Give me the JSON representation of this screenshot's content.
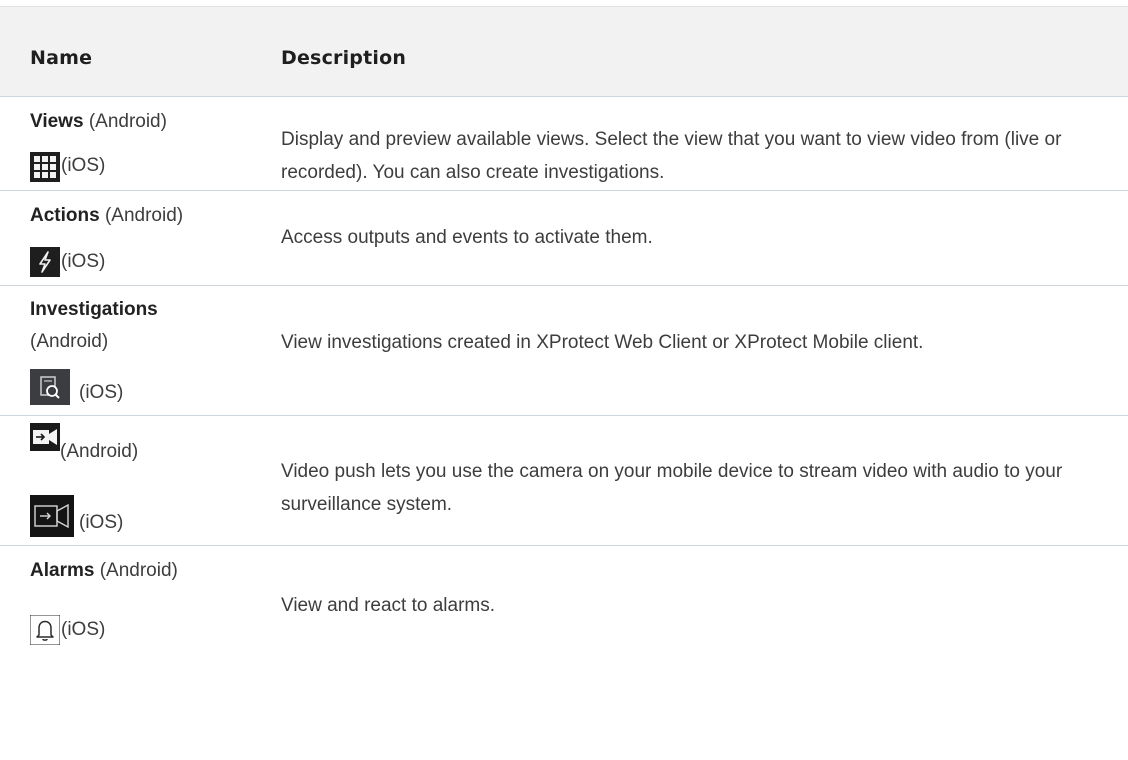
{
  "header": {
    "name": "Name",
    "description": "Description"
  },
  "rows": [
    {
      "title": "Views",
      "android": "(Android)",
      "ios": "(iOS)",
      "icon": "grid-icon",
      "description": "Display and preview available views. Select the view that you want to view video from (live or recorded). You can also create investigations."
    },
    {
      "title": "Actions",
      "android": "(Android)",
      "ios": "(iOS)",
      "icon": "lightning-icon",
      "description": "Access outputs and events to activate them."
    },
    {
      "title": "Investigations",
      "android": "(Android)",
      "ios": "(iOS)",
      "icon": "investigation-icon",
      "description": "View investigations created in XProtect Web Client or XProtect Mobile client."
    },
    {
      "android": "(Android)",
      "ios": "(iOS)",
      "icon_android": "video-push-icon",
      "icon": "video-push-outline-icon",
      "description": "Video push lets you use the camera on your mobile device to stream video with audio to your surveillance system."
    },
    {
      "title": "Alarms",
      "android": "(Android)",
      "ios": "(iOS)",
      "icon": "bell-icon",
      "description": "View and react to alarms."
    }
  ]
}
